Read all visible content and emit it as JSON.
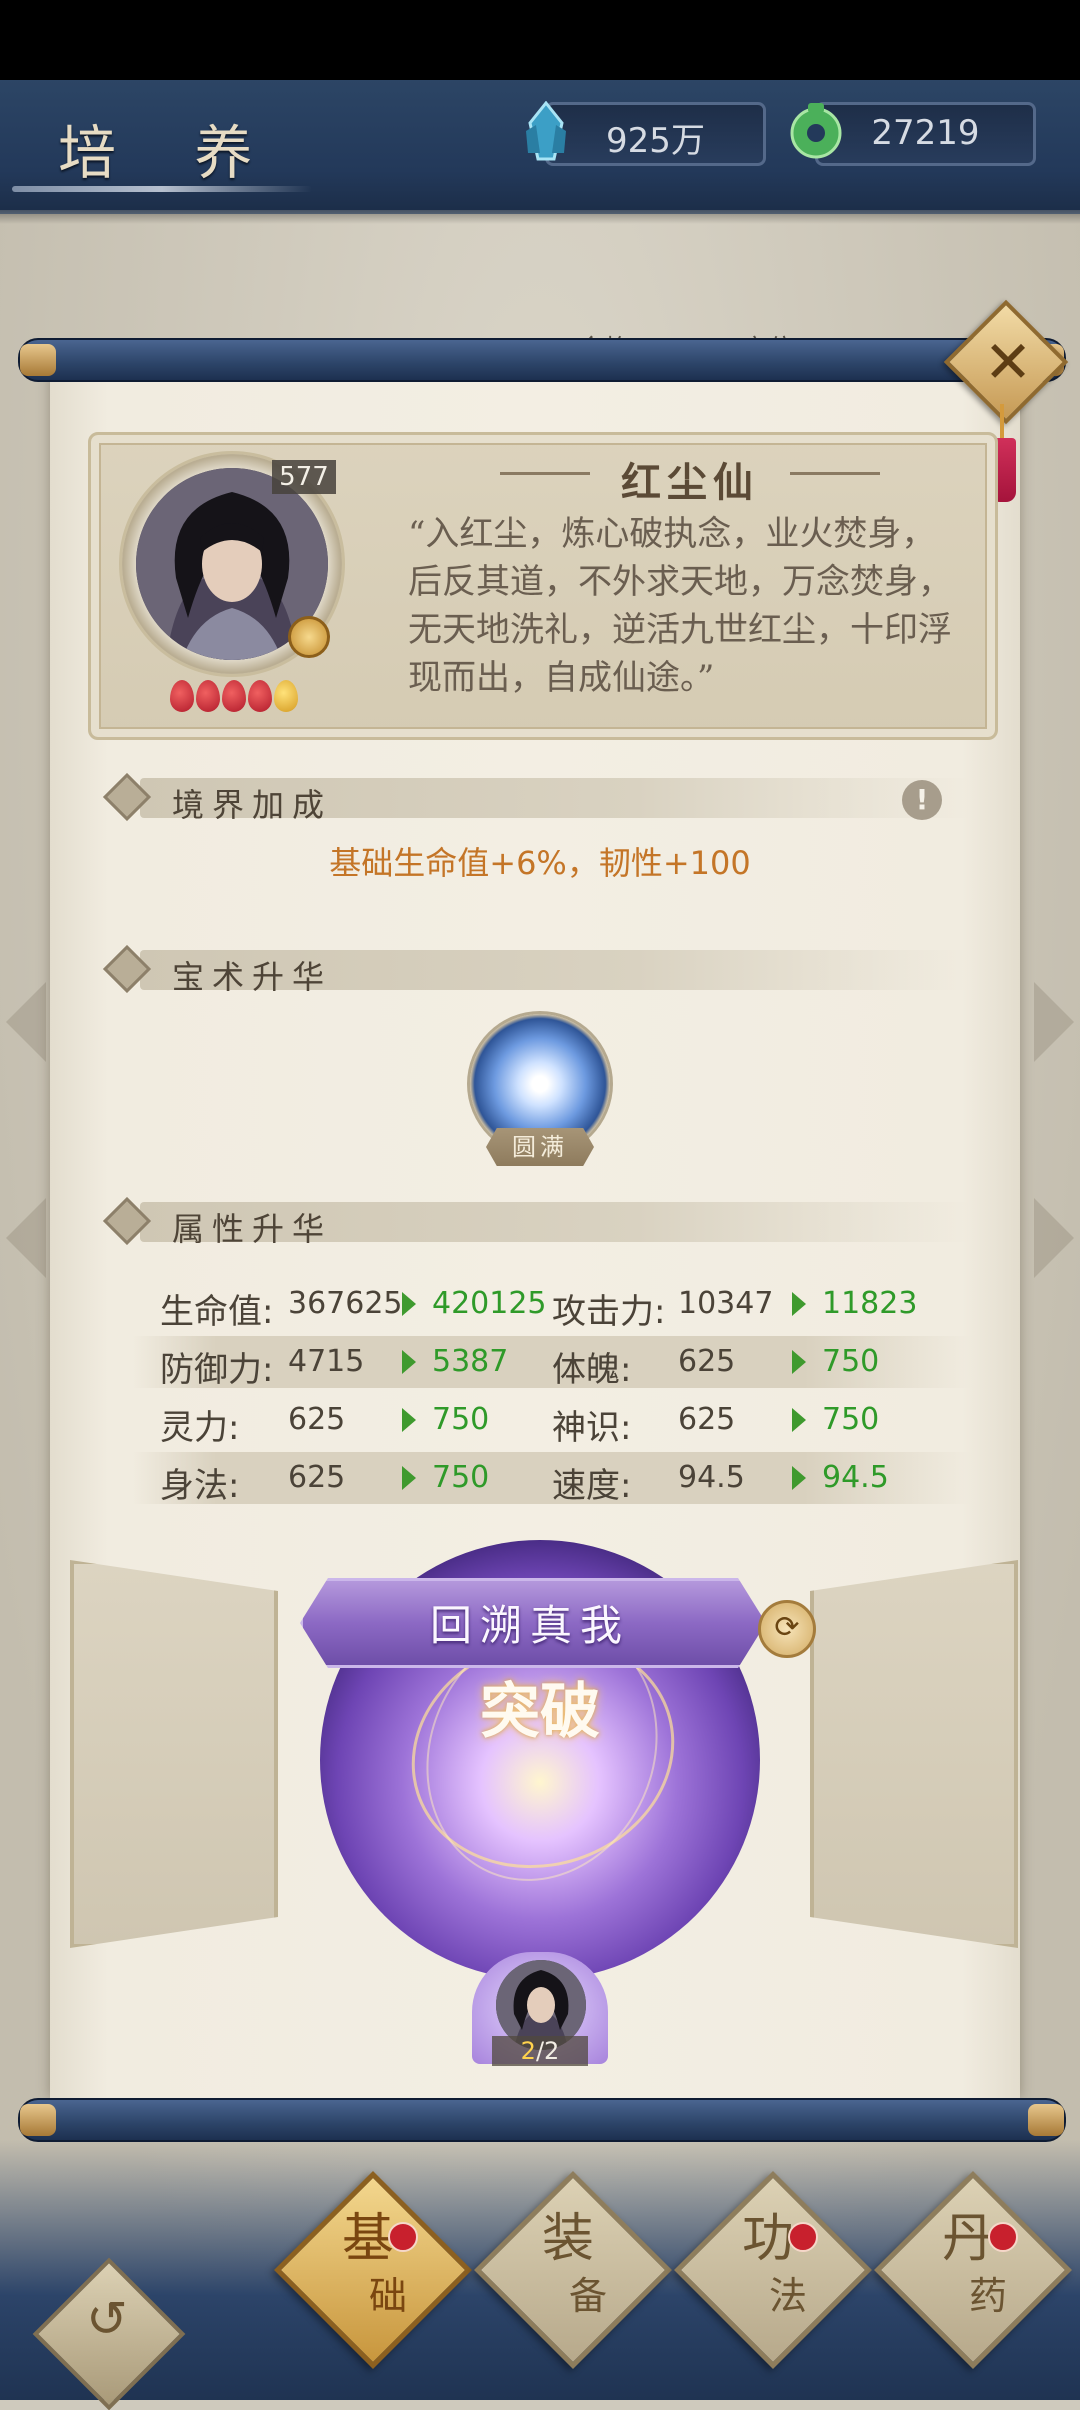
{
  "header": {
    "title": "培 养",
    "currency1": {
      "value": "925万",
      "icon": "crystal-icon",
      "color": "#4fb6d6"
    },
    "currency2": {
      "value": "27219",
      "icon": "jade-icon",
      "color": "#5ec46a"
    }
  },
  "background_tabs": [
    "命格",
    "定位"
  ],
  "character": {
    "name": "红尘仙",
    "level": "577",
    "stars_full": 4,
    "stars_half": 1,
    "description": "“入红尘，炼心破执念，业火焚身，后反其道，不外求天地，万念焚身，无天地洗礼，逆活九世红尘，十印浮现而出，自成仙途。”"
  },
  "sections": {
    "realm": {
      "title": "境界加成",
      "bonus": "基础生命值+6%，韧性+100"
    },
    "skill": {
      "title": "宝术升华",
      "skill_status": "圆满"
    },
    "attributes": {
      "title": "属性升华"
    }
  },
  "stats": [
    {
      "label": "生命值:",
      "value": "367625",
      "new": "420125",
      "label2": "攻击力:",
      "value2": "10347",
      "new2": "11823"
    },
    {
      "label": "防御力:",
      "value": "4715",
      "new": "5387",
      "label2": "体魄:",
      "value2": "625",
      "new2": "750"
    },
    {
      "label": "灵力:",
      "value": "625",
      "new": "750",
      "label2": "神识:",
      "value2": "625",
      "new2": "750"
    },
    {
      "label": "身法:",
      "value": "625",
      "new": "750",
      "label2": "速度:",
      "value2": "94.5",
      "new2": "94.5"
    }
  ],
  "breakthrough": {
    "banner": "回溯真我",
    "button": "突破",
    "count_current": "2",
    "count_total": "/2"
  },
  "nav": [
    {
      "line1": "基",
      "line2": "础",
      "active": true,
      "badge": true
    },
    {
      "line1": "装",
      "line2": "备",
      "active": false,
      "badge": false
    },
    {
      "line1": "功",
      "line2": "法",
      "active": false,
      "badge": true
    },
    {
      "line1": "丹",
      "line2": "药",
      "active": false,
      "badge": true
    }
  ],
  "colors": {
    "accent_gold": "#c8963d",
    "stat_up_green": "#2f9a29",
    "bonus_orange": "#c47527"
  }
}
